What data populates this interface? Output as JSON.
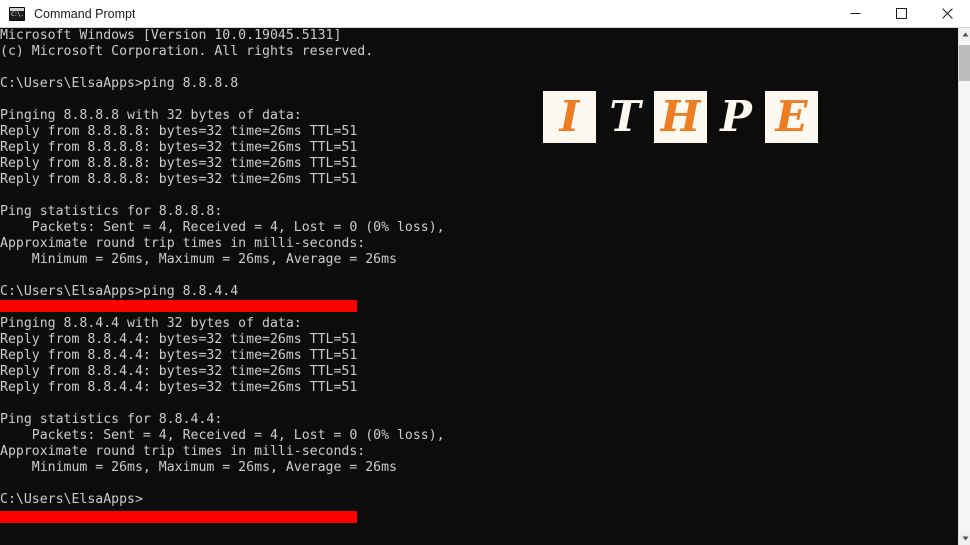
{
  "window": {
    "title": "Command Prompt",
    "icon": "command-prompt-icon",
    "icon_glyph": "C:\\.",
    "controls": {
      "minimize": "Minimize",
      "maximize": "Maximize",
      "close": "Close"
    }
  },
  "colors": {
    "titlebar_bg": "#ffffff",
    "console_bg": "#0c0c0c",
    "console_fg": "#cccccc",
    "redaction": "#fd0000",
    "logo_orange": "#ed7d22",
    "logo_cream": "#fdf8f0",
    "scrollbar_thumb": "#bdbdbd"
  },
  "console": {
    "text": "Microsoft Windows [Version 10.0.19045.5131]\n(c) Microsoft Corporation. All rights reserved.\n\nC:\\Users\\ElsaApps>ping 8.8.8.8\n\nPinging 8.8.8.8 with 32 bytes of data:\nReply from 8.8.8.8: bytes=32 time=26ms TTL=51\nReply from 8.8.8.8: bytes=32 time=26ms TTL=51\nReply from 8.8.8.8: bytes=32 time=26ms TTL=51\nReply from 8.8.8.8: bytes=32 time=26ms TTL=51\n\nPing statistics for 8.8.8.8:\n    Packets: Sent = 4, Received = 4, Lost = 0 (0% loss),\nApproximate round trip times in milli-seconds:\n    Minimum = 26ms, Maximum = 26ms, Average = 26ms\n\nC:\\Users\\ElsaApps>ping 8.8.4.4\n\nPinging 8.8.4.4 with 32 bytes of data:\nReply from 8.8.4.4: bytes=32 time=26ms TTL=51\nReply from 8.8.4.4: bytes=32 time=26ms TTL=51\nReply from 8.8.4.4: bytes=32 time=26ms TTL=51\nReply from 8.8.4.4: bytes=32 time=26ms TTL=51\n\nPing statistics for 8.8.4.4:\n    Packets: Sent = 4, Received = 4, Lost = 0 (0% loss),\nApproximate round trip times in milli-seconds:\n    Minimum = 26ms, Maximum = 26ms, Average = 26ms\n\nC:\\Users\\ElsaApps>",
    "lines": [
      "Microsoft Windows [Version 10.0.19045.5131]",
      "(c) Microsoft Corporation. All rights reserved.",
      "",
      "C:\\Users\\ElsaApps>ping 8.8.8.8",
      "",
      "Pinging 8.8.8.8 with 32 bytes of data:",
      "Reply from 8.8.8.8: bytes=32 time=26ms TTL=51",
      "Reply from 8.8.8.8: bytes=32 time=26ms TTL=51",
      "Reply from 8.8.8.8: bytes=32 time=26ms TTL=51",
      "Reply from 8.8.8.8: bytes=32 time=26ms TTL=51",
      "",
      "Ping statistics for 8.8.8.8:",
      "    Packets: Sent = 4, Received = 4, Lost = 0 (0% loss),",
      "Approximate round trip times in milli-seconds:",
      "    Minimum = 26ms, Maximum = 26ms, Average = 26ms",
      "",
      "C:\\Users\\ElsaApps>ping 8.8.4.4",
      "",
      "Pinging 8.8.4.4 with 32 bytes of data:",
      "Reply from 8.8.4.4: bytes=32 time=26ms TTL=51",
      "Reply from 8.8.4.4: bytes=32 time=26ms TTL=51",
      "Reply from 8.8.4.4: bytes=32 time=26ms TTL=51",
      "Reply from 8.8.4.4: bytes=32 time=26ms TTL=51",
      "",
      "Ping statistics for 8.8.4.4:",
      "    Packets: Sent = 4, Received = 4, Lost = 0 (0% loss),",
      "Approximate round trip times in milli-seconds:",
      "    Minimum = 26ms, Maximum = 26ms, Average = 26ms",
      "",
      "C:\\Users\\ElsaApps>"
    ]
  },
  "logo": {
    "name": "ITHPE",
    "letters": [
      {
        "char": "I",
        "style": "boxed"
      },
      {
        "char": "T",
        "style": "plain"
      },
      {
        "char": "H",
        "style": "boxed"
      },
      {
        "char": "P",
        "style": "plain"
      },
      {
        "char": "E",
        "style": "boxed"
      }
    ]
  },
  "scrollbar": {
    "up_arrow": "scroll-up-arrow",
    "down_arrow": "scroll-down-arrow",
    "thumb": "scroll-thumb"
  }
}
